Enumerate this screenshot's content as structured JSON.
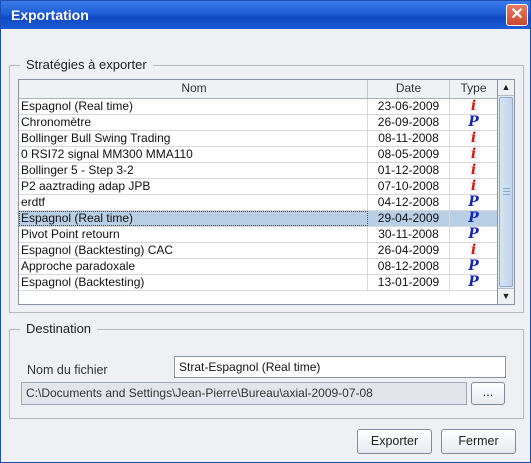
{
  "window": {
    "title": "Exportation",
    "close_glyph": "✕"
  },
  "strategies": {
    "legend": "Stratégies à exporter",
    "columns": [
      "Nom",
      "Date",
      "Type"
    ],
    "rows": [
      {
        "nom": "Espagnol (Real time)",
        "date": "23-06-2009",
        "type": "i"
      },
      {
        "nom": "Chronomètre",
        "date": "26-09-2008",
        "type": "p"
      },
      {
        "nom": "Bollinger Bull Swing Trading",
        "date": "08-11-2008",
        "type": "i"
      },
      {
        "nom": "0 RSI72 signal MM300 MMA110",
        "date": "08-05-2009",
        "type": "i"
      },
      {
        "nom": "Bollinger 5 - Step 3-2",
        "date": "01-12-2008",
        "type": "i"
      },
      {
        "nom": "P2 aaztrading adap JPB",
        "date": "07-10-2008",
        "type": "i"
      },
      {
        "nom": "erdtf",
        "date": "04-12-2008",
        "type": "p"
      },
      {
        "nom": "Espagnol (Real time)",
        "date": "29-04-2009",
        "type": "p",
        "selected": true
      },
      {
        "nom": "Pivot Point retourn",
        "date": "30-11-2008",
        "type": "p"
      },
      {
        "nom": "Espagnol (Backtesting) CAC",
        "date": "26-04-2009",
        "type": "i"
      },
      {
        "nom": "Approche paradoxale",
        "date": "08-12-2008",
        "type": "p"
      },
      {
        "nom": "Espagnol (Backtesting)",
        "date": "13-01-2009",
        "type": "p"
      }
    ],
    "type_glyphs": {
      "i": "i",
      "p": "P"
    },
    "type_colors": {
      "i": "#e0141b",
      "p": "#1428b8"
    },
    "scroll_up_glyph": "▲",
    "scroll_down_glyph": "▼"
  },
  "destination": {
    "legend": "Destination",
    "filename_label": "Nom du fichier",
    "filename_value": "Strat-Espagnol (Real time)",
    "path_value": "C:\\Documents and Settings\\Jean-Pierre\\Bureau\\axial-2009-07-08",
    "browse_label": "..."
  },
  "buttons": {
    "export_label": "Exporter",
    "close_label": "Fermer"
  }
}
